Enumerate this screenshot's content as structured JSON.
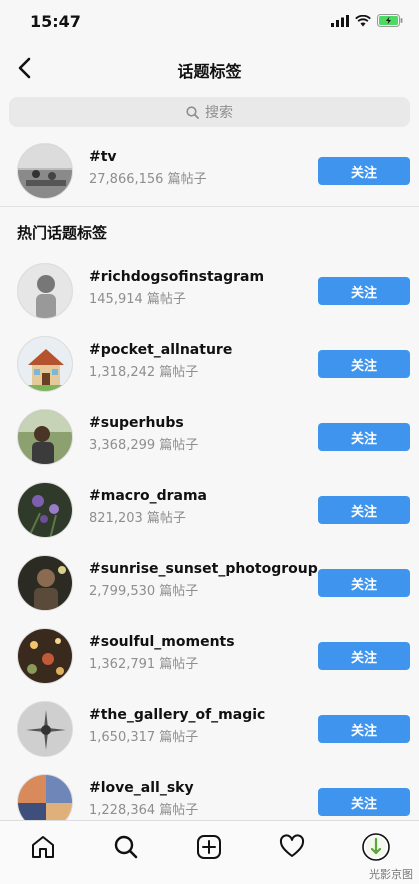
{
  "status_bar": {
    "time": "15:47"
  },
  "header": {
    "title": "话题标签"
  },
  "search": {
    "placeholder": "搜索"
  },
  "featured": {
    "tag": "#tv",
    "count": "27,866,156 篇帖子",
    "follow_label": "关注"
  },
  "section": {
    "title": "热门话题标签"
  },
  "hashtags": [
    {
      "tag": "#richdogsofinstagram",
      "count": "145,914 篇帖子",
      "follow_label": "关注"
    },
    {
      "tag": "#pocket_allnature",
      "count": "1,318,242 篇帖子",
      "follow_label": "关注"
    },
    {
      "tag": "#superhubs",
      "count": "3,368,299 篇帖子",
      "follow_label": "关注"
    },
    {
      "tag": "#macro_drama",
      "count": "821,203 篇帖子",
      "follow_label": "关注"
    },
    {
      "tag": "#sunrise_sunset_photogroup",
      "count": "2,799,530 篇帖子",
      "follow_label": "关注"
    },
    {
      "tag": "#soulful_moments",
      "count": "1,362,791 篇帖子",
      "follow_label": "关注"
    },
    {
      "tag": "#the_gallery_of_magic",
      "count": "1,650,317 篇帖子",
      "follow_label": "关注"
    },
    {
      "tag": "#love_all_sky",
      "count": "1,228,364 篇帖子",
      "follow_label": "关注"
    }
  ],
  "tab_bar": {
    "items": [
      "home-icon",
      "search-icon",
      "new-post-icon",
      "heart-icon",
      "profile-avatar"
    ]
  },
  "watermark": {
    "text": "光影京图"
  },
  "colors": {
    "accent": "#3f95ee",
    "battery": "#4cd964"
  }
}
